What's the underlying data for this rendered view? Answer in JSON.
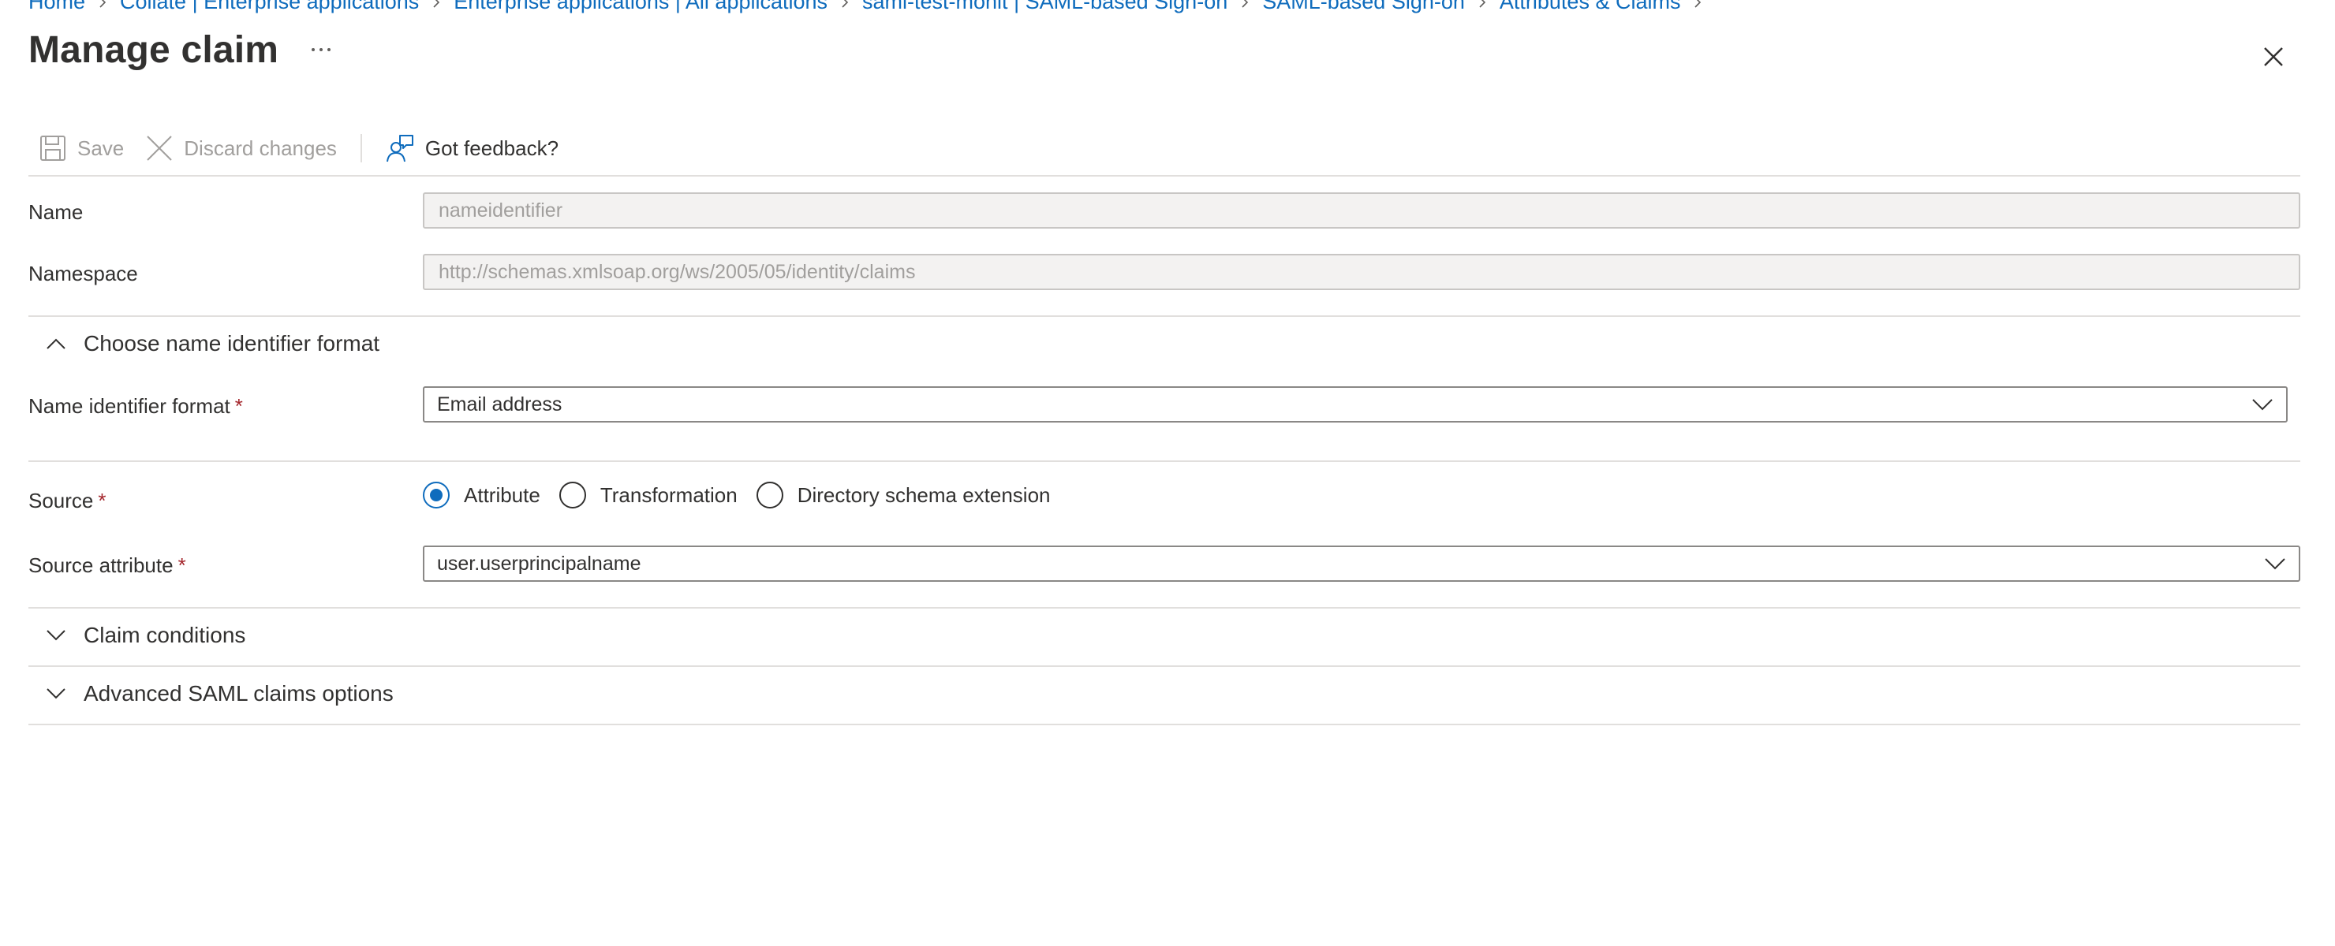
{
  "breadcrumb": [
    "Home",
    "Collate | Enterprise applications",
    "Enterprise applications | All applications",
    "saml-test-monit | SAML-based Sign-on",
    "SAML-based Sign-on",
    "Attributes & Claims"
  ],
  "title": "Manage claim",
  "more_glyph": "...",
  "toolbar": {
    "save_label": "Save",
    "discard_label": "Discard changes",
    "feedback_label": "Got feedback?"
  },
  "form": {
    "name_label": "Name",
    "name_value": "nameidentifier",
    "namespace_label": "Namespace",
    "namespace_value": "http://schemas.xmlsoap.org/ws/2005/05/identity/claims",
    "name_id_section_label": "Choose name identifier format",
    "name_id_format_label": "Name identifier format",
    "name_id_format_value": "Email address",
    "required_mark": "*",
    "source_label": "Source",
    "source_options": [
      "Attribute",
      "Transformation",
      "Directory schema extension"
    ],
    "source_selected": "Attribute",
    "source_attribute_label": "Source attribute",
    "source_attribute_value": "user.userprincipalname"
  },
  "sections": {
    "claim_conditions_label": "Claim conditions",
    "advanced_label": "Advanced SAML claims options"
  },
  "colors": {
    "accent": "#0f6cbd",
    "required": "#a4262c",
    "disabled_text": "#a19f9d",
    "readonly_bg": "#f3f2f1"
  }
}
